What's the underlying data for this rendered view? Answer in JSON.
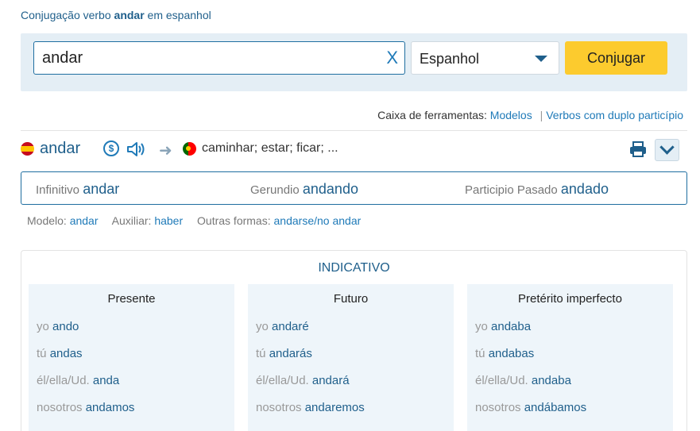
{
  "header": {
    "title_prefix": "Conjugação verbo",
    "title_verb": "andar",
    "title_suffix": "em espanhol"
  },
  "search": {
    "value": "andar",
    "clear_label": "X",
    "language": "Espanhol",
    "submit_label": "Conjugar"
  },
  "toolbox": {
    "label": "Caixa de ferramentas:",
    "link_models": "Modelos",
    "separator": "|",
    "link_double": "Verbos com duplo particípio"
  },
  "verb": {
    "name": "andar",
    "translations": "caminhar; estar; ficar; ...",
    "icons": [
      "spain-flag-icon",
      "dollar-icon",
      "speaker-icon",
      "arrow-right-icon",
      "portugal-flag-icon",
      "print-icon",
      "chevron-down-icon"
    ]
  },
  "forms": {
    "infinitive_label": "Infinitivo",
    "infinitive_value": "andar",
    "gerund_label": "Gerundio",
    "gerund_value": "andando",
    "participle_label": "Participio Pasado",
    "participle_value": "andado"
  },
  "meta": {
    "model_label": "Modelo:",
    "model_value": "andar",
    "aux_label": "Auxiliar:",
    "aux_value": "haber",
    "other_label": "Outras formas:",
    "other_value": "andarse/no andar"
  },
  "indicativo": {
    "title": "INDICATIVO",
    "tenses": [
      {
        "name": "Presente",
        "rows": [
          {
            "pronoun": "yo",
            "form": "ando"
          },
          {
            "pronoun": "tú",
            "form": "andas"
          },
          {
            "pronoun": "él/ella/Ud.",
            "form": "anda"
          },
          {
            "pronoun": "nosotros",
            "form": "andamos"
          }
        ]
      },
      {
        "name": "Futuro",
        "rows": [
          {
            "pronoun": "yo",
            "form": "andaré"
          },
          {
            "pronoun": "tú",
            "form": "andarás"
          },
          {
            "pronoun": "él/ella/Ud.",
            "form": "andará"
          },
          {
            "pronoun": "nosotros",
            "form": "andaremos"
          }
        ]
      },
      {
        "name": "Pretérito imperfecto",
        "rows": [
          {
            "pronoun": "yo",
            "form": "andaba"
          },
          {
            "pronoun": "tú",
            "form": "andabas"
          },
          {
            "pronoun": "él/ella/Ud.",
            "form": "andaba"
          },
          {
            "pronoun": "nosotros",
            "form": "andábamos"
          }
        ]
      }
    ]
  },
  "colors": {
    "primary": "#1f5f8b",
    "link": "#1f7ab8",
    "button": "#fccb2e",
    "panel": "#e4eef5"
  }
}
